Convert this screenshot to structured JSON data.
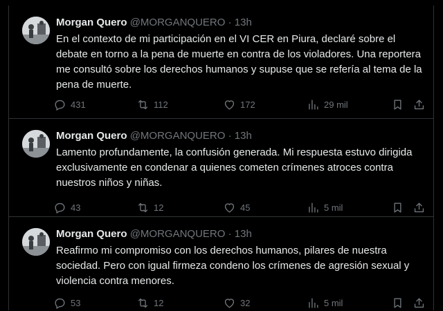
{
  "tweets": [
    {
      "name": "Morgan Quero",
      "handle": "@MORGANQUERO",
      "separator": "·",
      "time": "13h",
      "text": "En el contexto de mi participación en el VI CER en Piura, declaré sobre el debate en torno a la pena de muerte en contra de los violadores. Una reportera me consultó sobre los derechos humanos y supuse que se refería al tema de la pena de muerte.",
      "replies": "431",
      "retweets": "112",
      "likes": "172",
      "views": "29 mil"
    },
    {
      "name": "Morgan Quero",
      "handle": "@MORGANQUERO",
      "separator": "·",
      "time": "13h",
      "text": "Lamento profundamente, la confusión generada. Mi respuesta estuvo dirigida exclusivamente en condenar a quienes cometen crímenes atroces contra nuestros niños y niñas.",
      "replies": "43",
      "retweets": "12",
      "likes": "45",
      "views": "5 mil"
    },
    {
      "name": "Morgan Quero",
      "handle": "@MORGANQUERO",
      "separator": "·",
      "time": "13h",
      "text": "Reafirmo mi compromiso con los derechos humanos, pilares de nuestra sociedad. Pero con igual firmeza condeno los crímenes de agresión sexual y violencia contra menores.",
      "replies": "53",
      "retweets": "12",
      "likes": "32",
      "views": "5 mil"
    }
  ],
  "icons": {
    "reply": "reply-icon",
    "retweet": "retweet-icon",
    "like": "heart-icon",
    "views": "views-icon",
    "bookmark": "bookmark-icon",
    "share": "share-icon"
  },
  "colors": {
    "background": "#000000",
    "text": "#e7e9ea",
    "secondary": "#71767b",
    "border": "#2f3336"
  }
}
